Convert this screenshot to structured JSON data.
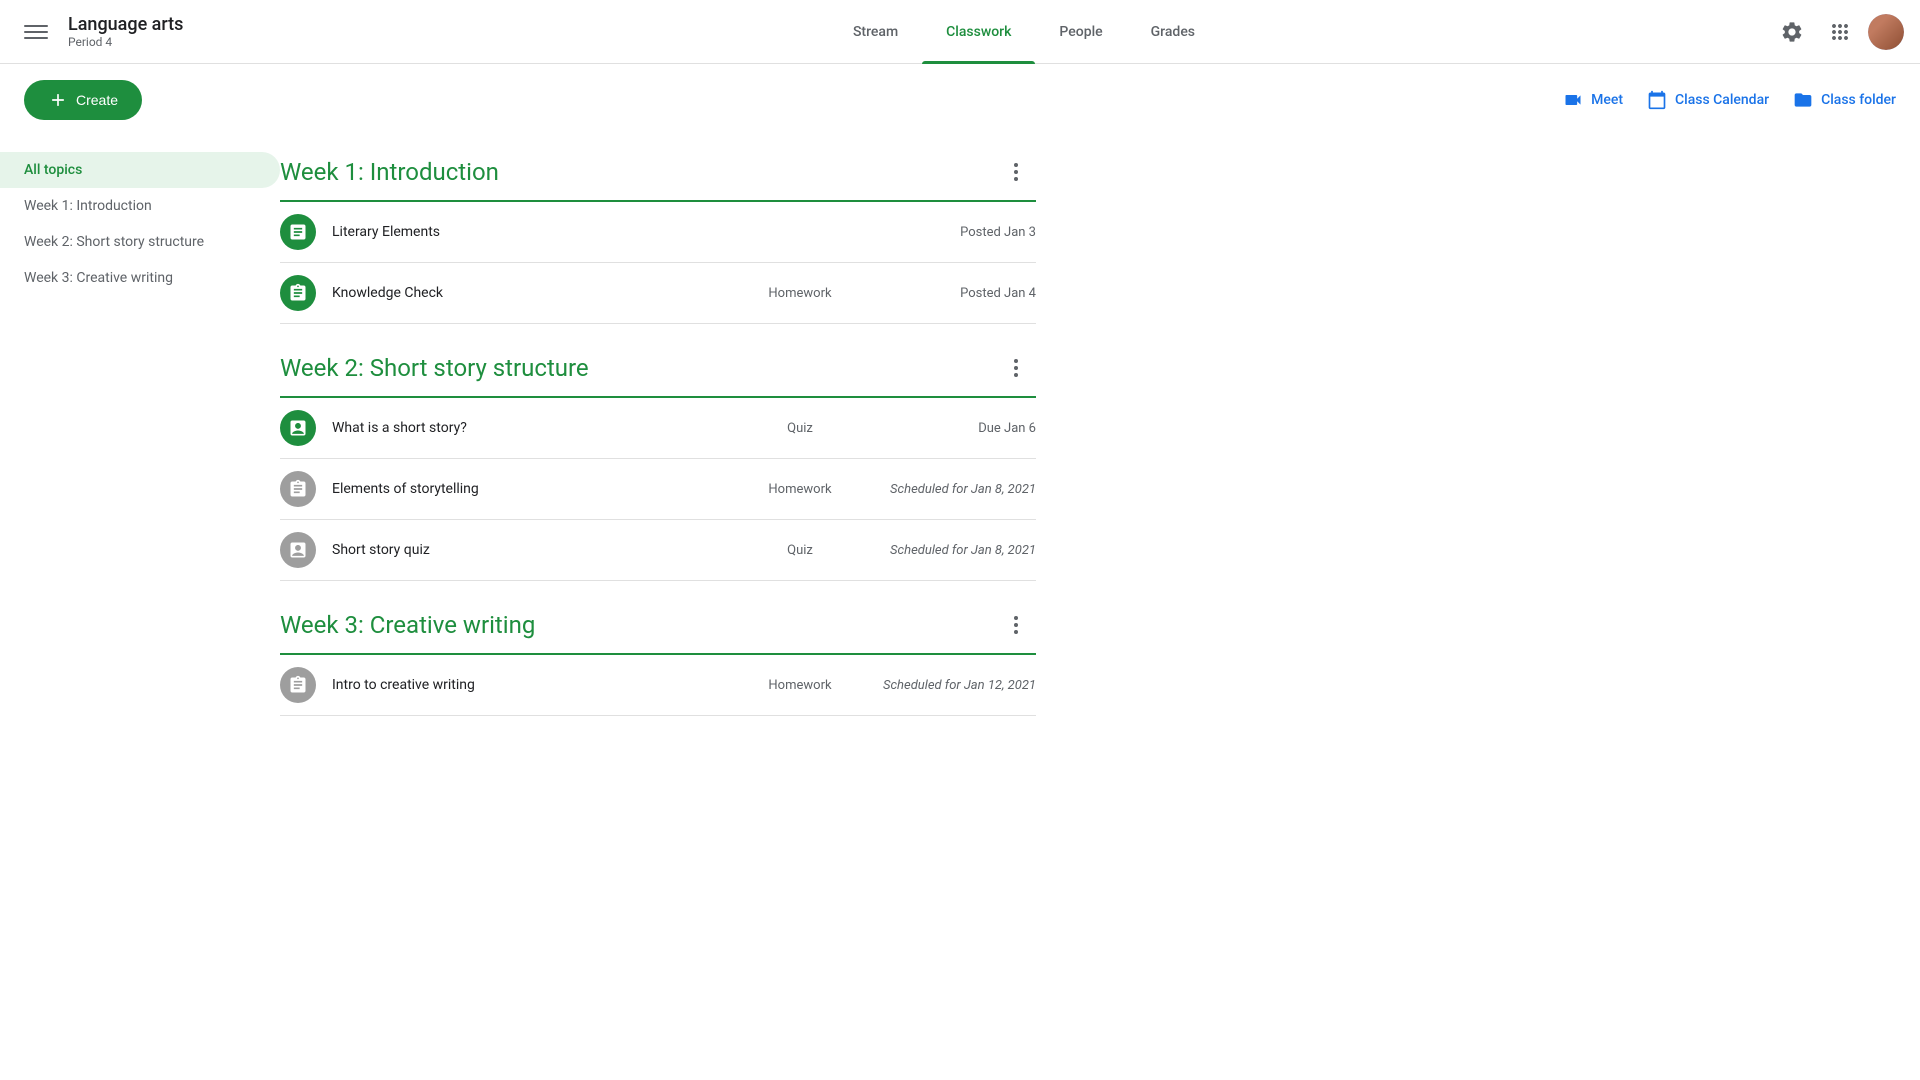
{
  "header": {
    "menu_icon": "☰",
    "app_title": "Language arts",
    "app_subtitle": "Period 4",
    "nav": [
      {
        "id": "stream",
        "label": "Stream",
        "active": false
      },
      {
        "id": "classwork",
        "label": "Classwork",
        "active": true
      },
      {
        "id": "people",
        "label": "People",
        "active": false
      },
      {
        "id": "grades",
        "label": "Grades",
        "active": false
      }
    ],
    "settings_icon": "gear-icon",
    "apps_icon": "grid-icon",
    "avatar_icon": "avatar-icon"
  },
  "toolbar": {
    "create_label": "Create",
    "meet_label": "Meet",
    "calendar_label": "Class Calendar",
    "folder_label": "Class folder"
  },
  "sidebar": {
    "items": [
      {
        "id": "all-topics",
        "label": "All topics",
        "active": true
      },
      {
        "id": "week1",
        "label": "Week 1: Introduction",
        "active": false
      },
      {
        "id": "week2",
        "label": "Week 2: Short story structure",
        "active": false
      },
      {
        "id": "week3",
        "label": "Week 3: Creative writing",
        "active": false
      }
    ]
  },
  "content": {
    "sections": [
      {
        "id": "week1",
        "title": "Week 1: Introduction",
        "assignments": [
          {
            "id": "literary-elements",
            "name": "Literary Elements",
            "type": "",
            "date": "Posted Jan 3",
            "icon_type": "material",
            "icon_color": "green",
            "scheduled": false
          },
          {
            "id": "knowledge-check",
            "name": "Knowledge Check",
            "type": "Homework",
            "date": "Posted Jan 4",
            "icon_type": "assignment",
            "icon_color": "green",
            "scheduled": false
          }
        ]
      },
      {
        "id": "week2",
        "title": "Week 2: Short story structure",
        "assignments": [
          {
            "id": "what-is-short-story",
            "name": "What is a short story?",
            "type": "Quiz",
            "date": "Due Jan 6",
            "icon_type": "quiz",
            "icon_color": "green",
            "scheduled": false
          },
          {
            "id": "elements-storytelling",
            "name": "Elements of storytelling",
            "type": "Homework",
            "date": "Scheduled for Jan 8, 2021",
            "icon_type": "assignment",
            "icon_color": "gray",
            "scheduled": true
          },
          {
            "id": "short-story-quiz",
            "name": "Short story quiz",
            "type": "Quiz",
            "date": "Scheduled for Jan 8, 2021",
            "icon_type": "quiz",
            "icon_color": "gray",
            "scheduled": true
          }
        ]
      },
      {
        "id": "week3",
        "title": "Week 3: Creative writing",
        "assignments": [
          {
            "id": "intro-creative-writing",
            "name": "Intro to creative writing",
            "type": "Homework",
            "date": "Scheduled for Jan 12, 2021",
            "icon_type": "assignment",
            "icon_color": "gray",
            "scheduled": true
          }
        ]
      }
    ]
  }
}
